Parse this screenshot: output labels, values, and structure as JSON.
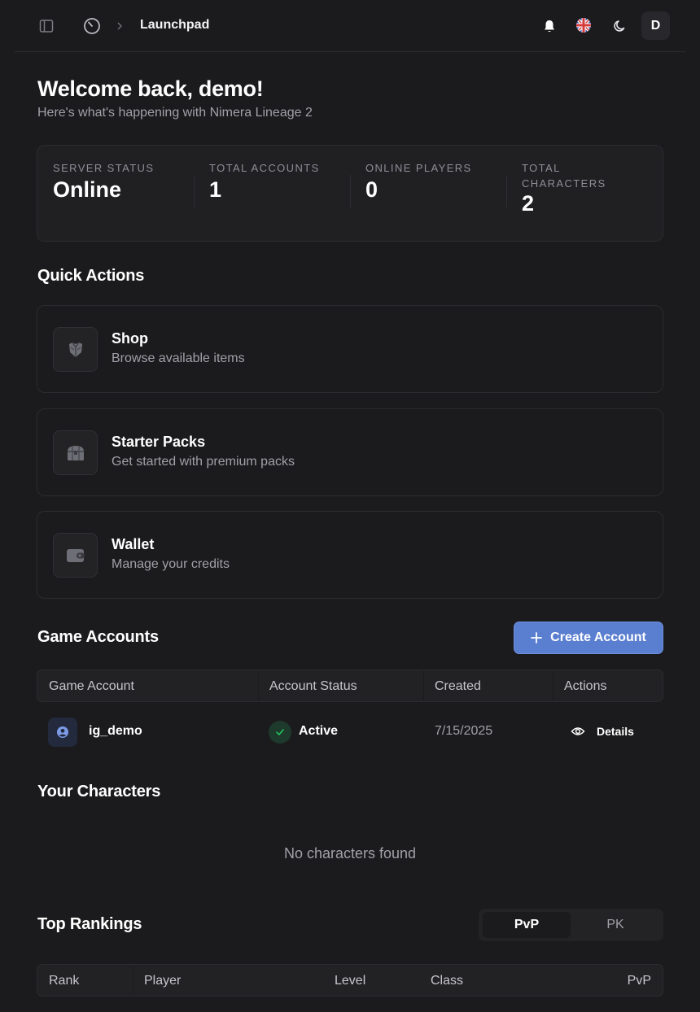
{
  "header": {
    "breadcrumb_title": "Launchpad",
    "avatar_initial": "D"
  },
  "welcome": {
    "title": "Welcome back, demo!",
    "subtitle": "Here's what's happening with Nimera Lineage 2"
  },
  "stats": [
    {
      "label": "SERVER STATUS",
      "value": "Online"
    },
    {
      "label": "TOTAL ACCOUNTS",
      "value": "1"
    },
    {
      "label": "ONLINE PLAYERS",
      "value": "0"
    },
    {
      "label": "TOTAL CHARACTERS",
      "value": "2"
    }
  ],
  "quick_actions": {
    "title": "Quick Actions",
    "items": [
      {
        "title": "Shop",
        "description": "Browse available items",
        "icon": "armor-icon"
      },
      {
        "title": "Starter Packs",
        "description": "Get started with premium packs",
        "icon": "chest-icon"
      },
      {
        "title": "Wallet",
        "description": "Manage your credits",
        "icon": "wallet-icon"
      }
    ]
  },
  "game_accounts": {
    "title": "Game Accounts",
    "create_label": "Create Account",
    "columns": [
      "Game Account",
      "Account Status",
      "Created",
      "Actions"
    ],
    "rows": [
      {
        "name": "ig_demo",
        "status": "Active",
        "created": "7/15/2025",
        "action": "Details"
      }
    ]
  },
  "characters": {
    "title": "Your Characters",
    "empty": "No characters found"
  },
  "rankings": {
    "title": "Top Rankings",
    "tabs": [
      "PvP",
      "PK"
    ],
    "active_tab": "PvP",
    "columns": [
      "Rank",
      "Player",
      "Level",
      "Class",
      "PvP"
    ]
  },
  "colors": {
    "background": "#1b1b1d",
    "accent": "#5a7fd0",
    "success": "#22c55e"
  }
}
